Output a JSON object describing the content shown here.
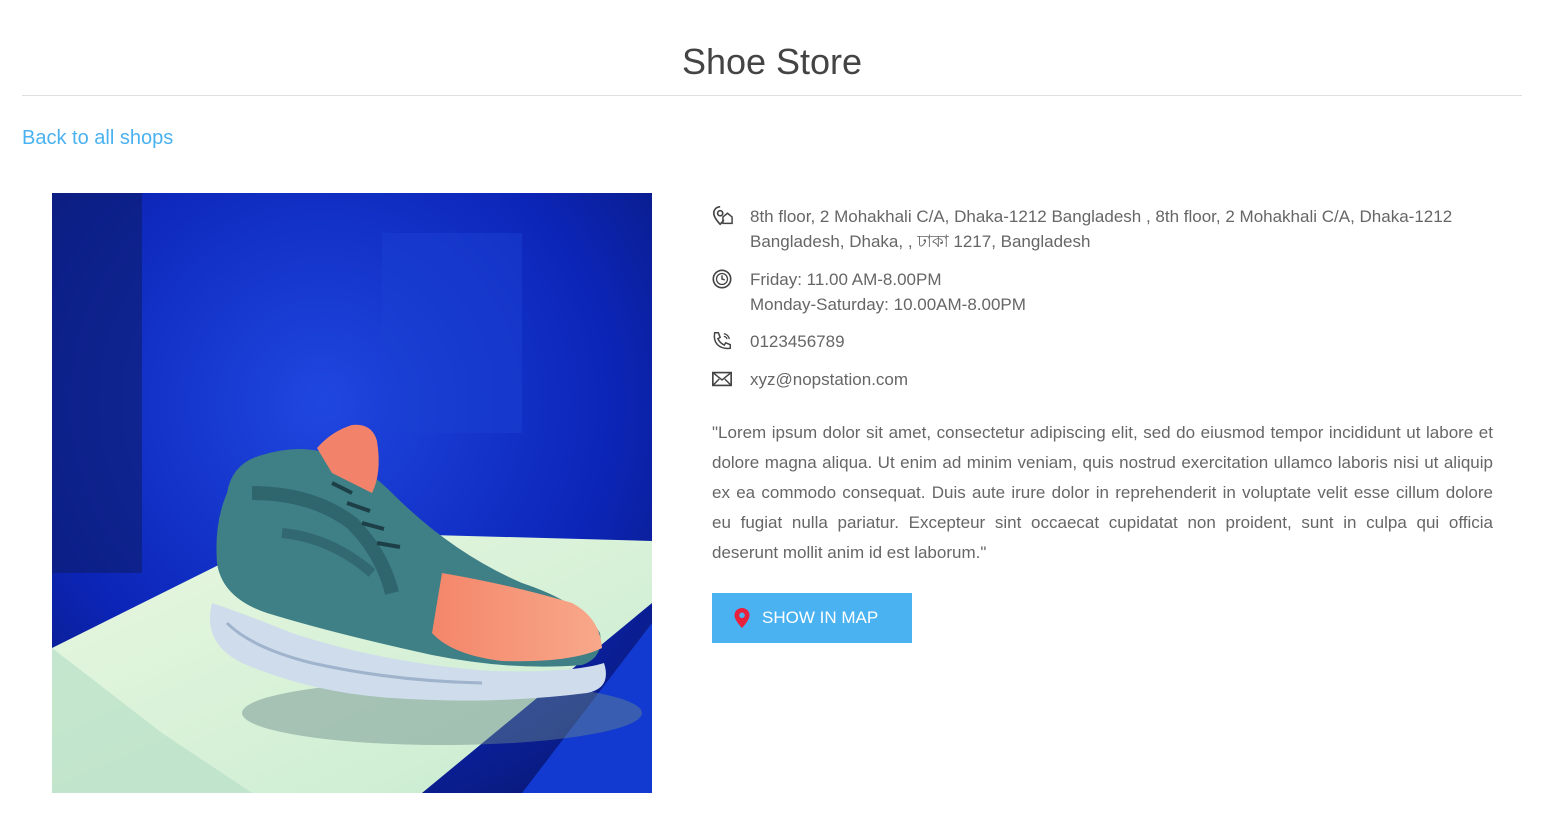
{
  "header": {
    "title": "Shoe Store"
  },
  "nav": {
    "back_label": "Back to all shops"
  },
  "shop": {
    "image_alt": "Sneaker on a pedestal",
    "address": "8th floor, 2 Mohakhali C/A, Dhaka-1212 Bangladesh , 8th floor, 2 Mohakhali C/A, Dhaka-1212 Bangladesh, Dhaka, , ঢাকা 1217, Bangladesh",
    "hours_line1": "Friday: 11.00 AM-8.00PM",
    "hours_line2": "Monday-Saturday: 10.00AM-8.00PM",
    "phone": "0123456789",
    "email": "xyz@nopstation.com",
    "description": "\"Lorem ipsum dolor sit amet, consectetur adipiscing elit, sed do eiusmod tempor incididunt ut labore et dolore magna aliqua. Ut enim ad minim veniam, quis nostrud exercitation ullamco laboris nisi ut aliquip ex ea commodo consequat. Duis aute irure dolor in reprehenderit in voluptate velit esse cillum dolore eu fugiat nulla pariatur. Excepteur sint occaecat cupidatat non proident, sunt in culpa qui officia deserunt mollit anim id est laborum.\""
  },
  "actions": {
    "map_label": "SHOW IN MAP"
  },
  "icons": {
    "address": "location-icon",
    "hours": "clock-icon",
    "phone": "phone-icon",
    "email": "mail-icon",
    "map": "map-pin-icon"
  },
  "colors": {
    "accent": "#4ab2f1",
    "pin": "#e8213c",
    "text": "#666666",
    "title": "#444444"
  }
}
